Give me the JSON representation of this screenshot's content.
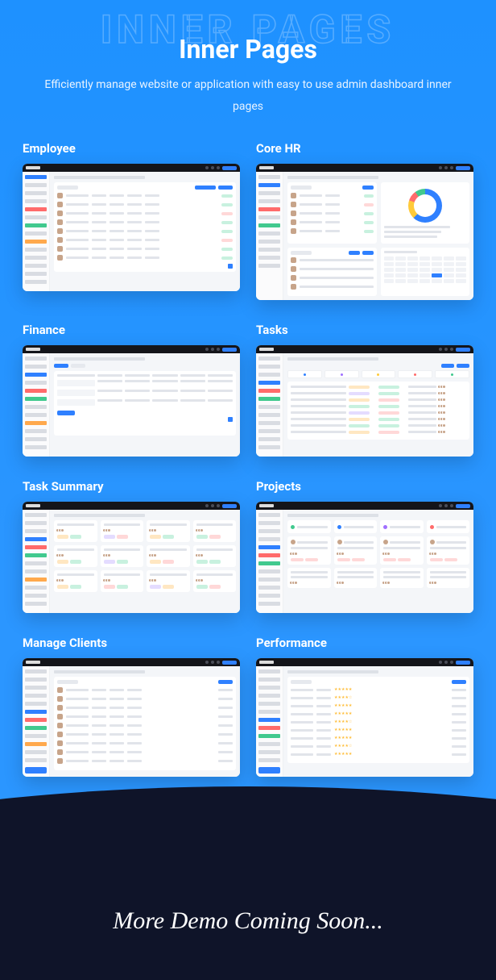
{
  "watermark": "INNER PAGES",
  "title": "Inner Pages",
  "subtitle": "Efficiently manage website or application with easy to use admin dashboard inner pages",
  "sections": {
    "employee": "Employee",
    "corehr": "Core HR",
    "finance": "Finance",
    "tasks": "Tasks",
    "tasksummary": "Task Summary",
    "projects": "Projects",
    "manageclients": "Manage Clients",
    "performance": "Performance"
  },
  "footer": "More Demo Coming Soon..."
}
